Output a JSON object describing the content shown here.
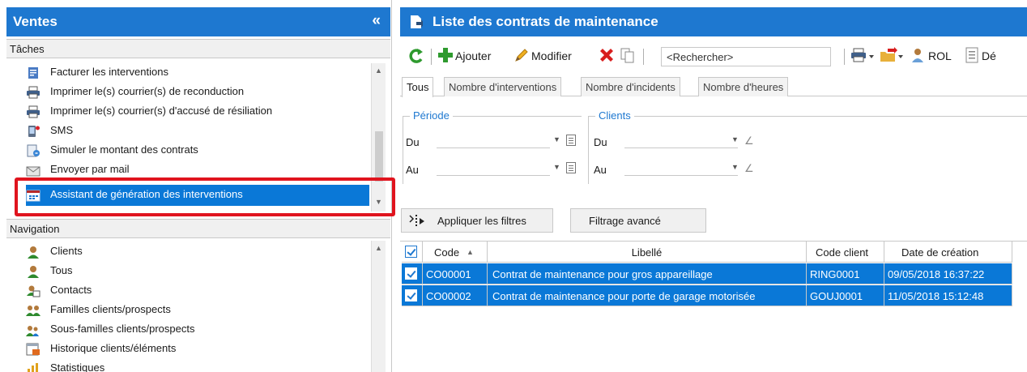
{
  "ventes": {
    "title": "Ventes",
    "collapse": "«",
    "taches": {
      "header": "Tâches",
      "items": [
        {
          "label": "Facturer les interventions",
          "icon": "invoice-icon"
        },
        {
          "label": "Imprimer le(s) courrier(s) de reconduction",
          "icon": "printer-icon"
        },
        {
          "label": "Imprimer le(s) courrier(s) d'accusé de résiliation",
          "icon": "printer-icon"
        },
        {
          "label": "SMS",
          "icon": "sms-phone-icon"
        },
        {
          "label": "Simuler le montant des contrats",
          "icon": "simulate-icon"
        },
        {
          "label": "Envoyer par mail",
          "icon": "email-icon"
        },
        {
          "label": "Assistant de génération des interventions",
          "icon": "calendar-icon",
          "selected": true
        }
      ]
    },
    "navigation": {
      "header": "Navigation",
      "items": [
        {
          "label": "Clients",
          "icon": "user-icon"
        },
        {
          "label": "Tous",
          "icon": "user-icon"
        },
        {
          "label": "Contacts",
          "icon": "contact-card-icon"
        },
        {
          "label": "Familles clients/prospects",
          "icon": "users-group-icon"
        },
        {
          "label": "Sous-familles clients/prospects",
          "icon": "users-subgroup-icon"
        },
        {
          "label": "Historique clients/éléments",
          "icon": "history-icon"
        },
        {
          "label": "Statistiques",
          "icon": "statistics-icon"
        }
      ]
    }
  },
  "main": {
    "title": "Liste des contrats de maintenance",
    "toolbar": {
      "ajouter": "Ajouter",
      "modifier": "Modifier",
      "search_placeholder": "<Rechercher>",
      "rol": "ROL",
      "de": "Dé"
    },
    "tabs": [
      "Tous",
      "Nombre d'interventions",
      "Nombre d'incidents",
      "Nombre d'heures"
    ],
    "filters": {
      "periode": {
        "legend": "Période",
        "du": "Du",
        "au": "Au"
      },
      "clients": {
        "legend": "Clients",
        "du": "Du",
        "au": "Au"
      }
    },
    "buttons": {
      "apply": "Appliquer les filtres",
      "advanced": "Filtrage avancé"
    },
    "grid": {
      "columns": [
        "Code",
        "Libellé",
        "Code client",
        "Date de création"
      ],
      "rows": [
        {
          "code": "CO00001",
          "libelle": "Contrat de maintenance pour gros appareillage",
          "code_client": "RING0001",
          "date": "09/05/2018 16:37:22"
        },
        {
          "code": "CO00002",
          "libelle": "Contrat de maintenance pour porte de garage motorisée",
          "code_client": "GOUJ0001",
          "date": "11/05/2018 15:12:48"
        }
      ]
    }
  },
  "colors": {
    "accent": "#1e78d0",
    "selection": "#0a78d7",
    "highlight": "#e0141e",
    "add_green": "#2e9a2e",
    "delete_red": "#d81e1e"
  }
}
